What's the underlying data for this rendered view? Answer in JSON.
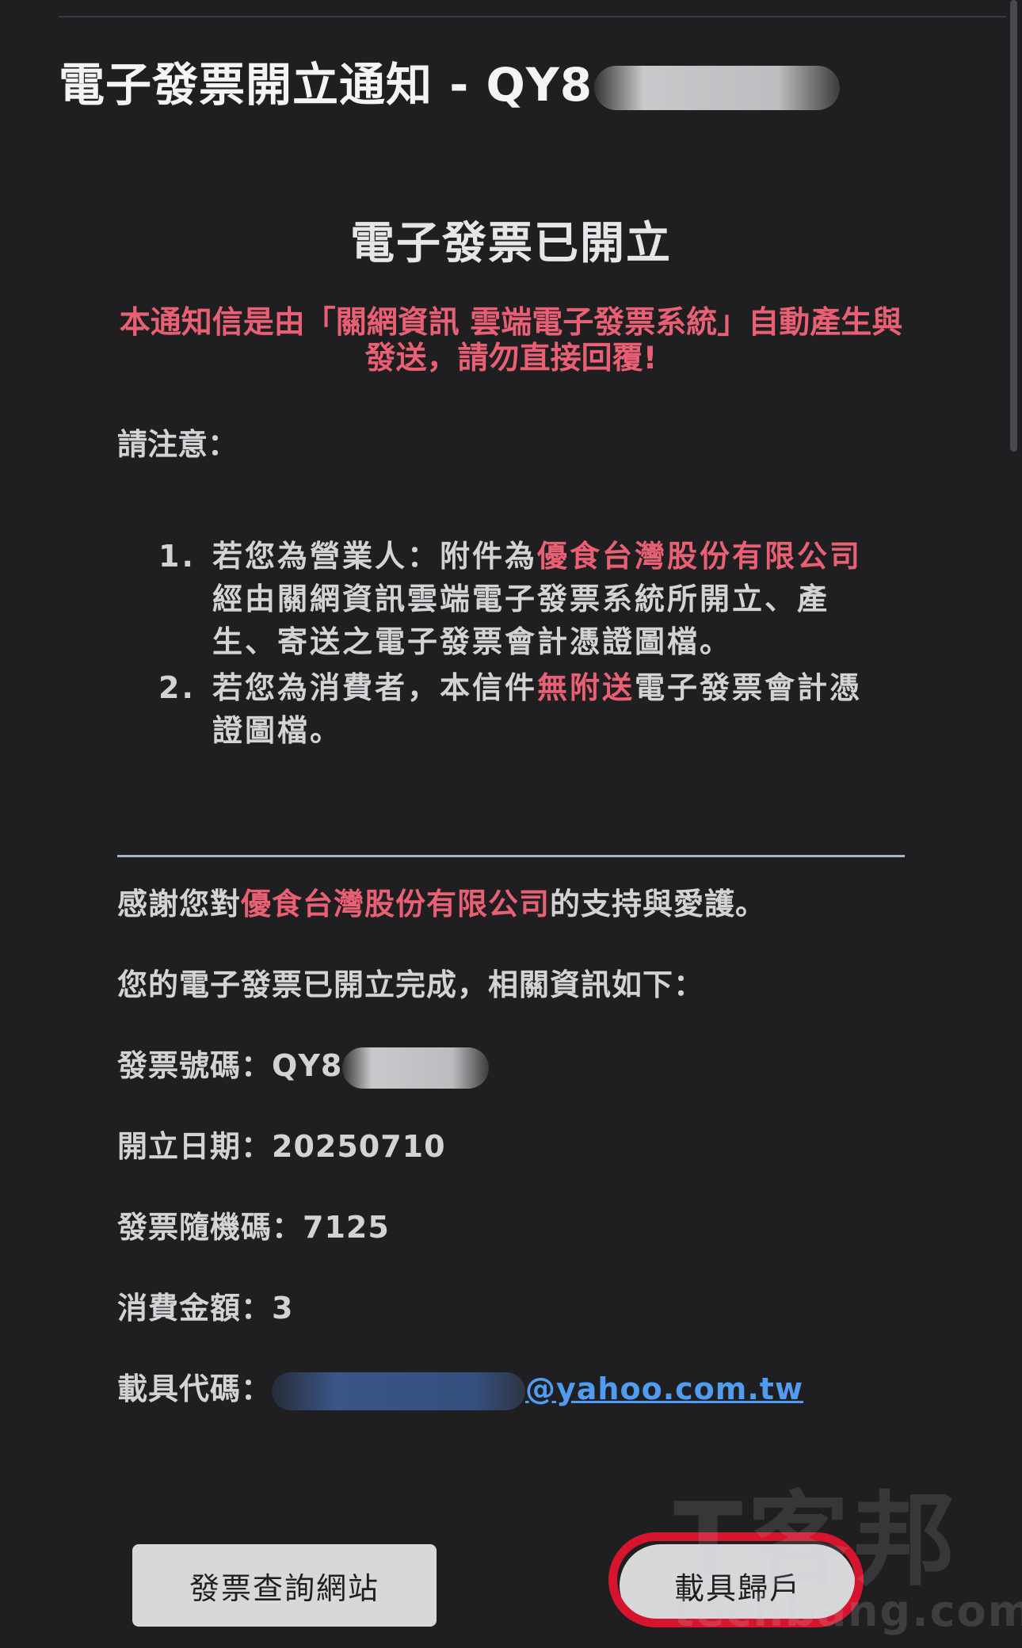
{
  "email": {
    "subject_prefix": "電子發票開立通知 - QY8",
    "heading": "電子發票已開立",
    "notice": "本通知信是由「關網資訊 雲端電子發票系統」自動產生與發送，請勿直接回覆!",
    "attention_label": "請注意：",
    "notes": [
      {
        "num": "1.",
        "text_a": "若您為營業人：附件為",
        "highlight": "優食台灣股份有限公司",
        "text_b": "經由關網資訊雲端電子發票系統所開立、產生、寄送之電子發票會計憑證圖檔。"
      },
      {
        "num": "2.",
        "text_a": "若您為消費者，本信件",
        "highlight": "無附送",
        "text_b": "電子發票會計憑證圖檔。"
      }
    ],
    "thanks": {
      "prefix": "感謝您對",
      "company": "優食台灣股份有限公司",
      "suffix": "的支持與愛護。"
    },
    "intro": "您的電子發票已開立完成，相關資訊如下：",
    "invoice_number": {
      "label": "發票號碼：",
      "value": "QY8"
    },
    "issue_date": {
      "label": "開立日期：",
      "value": "20250710"
    },
    "random_code": {
      "label": "發票隨機碼：",
      "value": "7125"
    },
    "amount": {
      "label": "消費金額：",
      "value": "3"
    },
    "carrier": {
      "label": "載具代碼：",
      "email_suffix": "@yahoo.com.tw"
    }
  },
  "buttons": {
    "invoice_query": "發票查詢網站",
    "carrier_link": "載具歸戶"
  },
  "watermark": {
    "logo": "T客邦",
    "site": "techbang.com"
  },
  "colors": {
    "background": "#1f1f21",
    "highlight_red": "#e95f74",
    "link_blue": "#4f9cf0",
    "annotation_ring": "#d6142d",
    "button_bg": "#d8d8db"
  }
}
